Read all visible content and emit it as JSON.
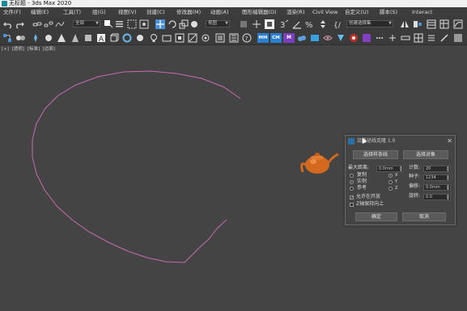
{
  "window": {
    "title": "无标题 - 3ds Max 2020"
  },
  "menu": [
    "文件(F)",
    "编辑(E)",
    "工具(T)",
    "组(G)",
    "视图(V)",
    "创建(C)",
    "修改器(M)",
    "动画(A)",
    "图形编辑器(D)",
    "渲染(R)",
    "Civil View",
    "自定义(U)",
    "脚本(S)",
    "Interact"
  ],
  "toolbar": {
    "selection_filter": "全部",
    "ref_coord": "视图",
    "named_selection": "创建选择集",
    "tool_mm": "MM",
    "tool_cm": "CM",
    "tool_m": "M"
  },
  "viewport_label": [
    "[+]",
    "[透视]",
    "[标准]",
    "[边面]"
  ],
  "dialog": {
    "title": "沿路径线克隆 1.0",
    "pick_spline": "选择样条线",
    "pick_object": "选择对象",
    "max_distance_label": "最大距离:",
    "max_distance_value": "0.0mm",
    "count_label": "计数:",
    "count_value": "20",
    "copy": "复制",
    "instance": "实例",
    "reference": "参考",
    "axis_x": "X",
    "axis_y": "Y",
    "axis_z": "Z",
    "seed_label": "种子:",
    "seed_value": "1234",
    "offset_label": "偏移:",
    "offset_value": "0.0mm",
    "rotate_label": "旋转:",
    "rotate_value": "0.0",
    "allow_open": "允许在开放",
    "z_axis_up": "Z轴保持向上",
    "ok": "确定",
    "cancel": "取消"
  },
  "colors": {
    "spline": "#c86bb0",
    "teapot": "#d2691e",
    "viewport_bg": "#444444"
  }
}
